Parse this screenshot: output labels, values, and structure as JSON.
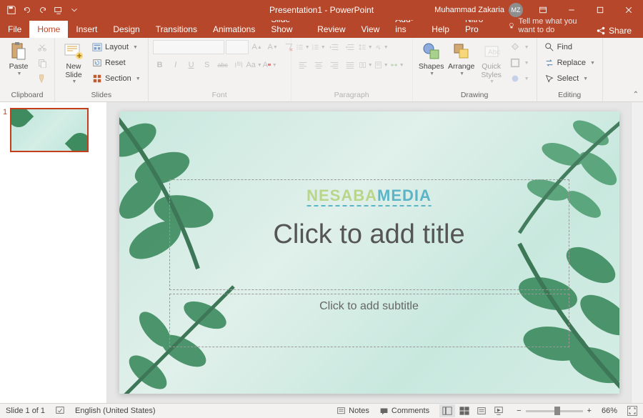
{
  "title": "Presentation1 - PowerPoint",
  "user": {
    "name": "Muhammad Zakaria",
    "initials": "MZ"
  },
  "tabs": {
    "file": "File",
    "home": "Home",
    "insert": "Insert",
    "design": "Design",
    "transitions": "Transitions",
    "animations": "Animations",
    "slideshow": "Slide Show",
    "review": "Review",
    "view": "View",
    "addins": "Add-ins",
    "help": "Help",
    "nitro": "Nitro Pro"
  },
  "tellme": "Tell me what you want to do",
  "share": "Share",
  "ribbon": {
    "clipboard": {
      "paste": "Paste",
      "label": "Clipboard"
    },
    "slides": {
      "new_slide": "New\nSlide",
      "layout": "Layout",
      "reset": "Reset",
      "section": "Section",
      "label": "Slides"
    },
    "font": {
      "label": "Font",
      "bold": "B",
      "italic": "I",
      "underline": "U",
      "strike": "abc"
    },
    "paragraph": {
      "label": "Paragraph"
    },
    "drawing": {
      "shapes": "Shapes",
      "arrange": "Arrange",
      "quick": "Quick\nStyles",
      "label": "Drawing"
    },
    "editing": {
      "find": "Find",
      "replace": "Replace",
      "select": "Select",
      "label": "Editing"
    }
  },
  "thumb": {
    "num": "1"
  },
  "slide": {
    "title": "Click to add title",
    "subtitle": "Click to add subtitle",
    "wm1": "NESABA",
    "wm2": "MEDIA"
  },
  "status": {
    "slide": "Slide 1 of 1",
    "lang": "English (United States)",
    "notes": "Notes",
    "comments": "Comments",
    "zoom": "66%"
  }
}
